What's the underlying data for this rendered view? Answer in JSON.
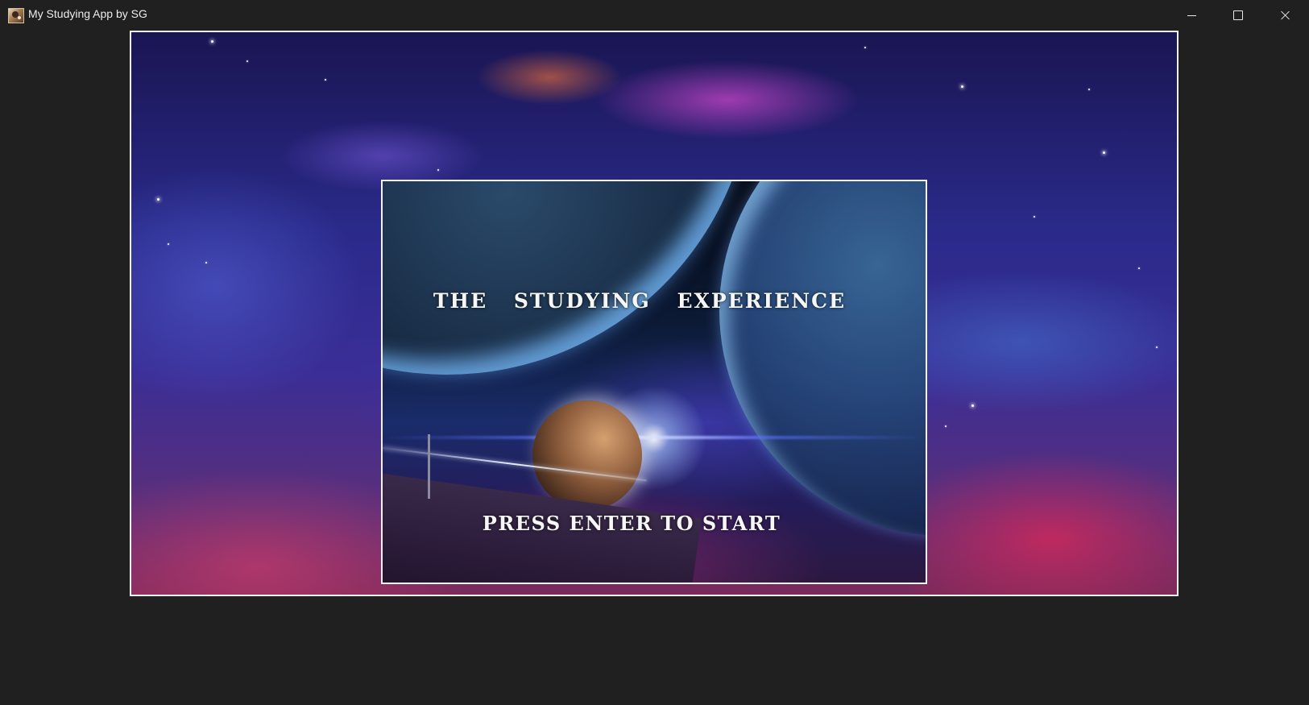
{
  "window": {
    "title": "My Studying App by SG",
    "icon": "app-icon",
    "controls": {
      "minimize": "minimize-icon",
      "maximize": "maximize-icon",
      "close": "close-icon"
    }
  },
  "start_screen": {
    "title": "THE   STUDYING   EXPERIENCE",
    "prompt": "PRESS ENTER TO START"
  },
  "colors": {
    "window_bg": "#202020",
    "frame_border": "#f2f2f2",
    "text": "#f6f6f6"
  }
}
